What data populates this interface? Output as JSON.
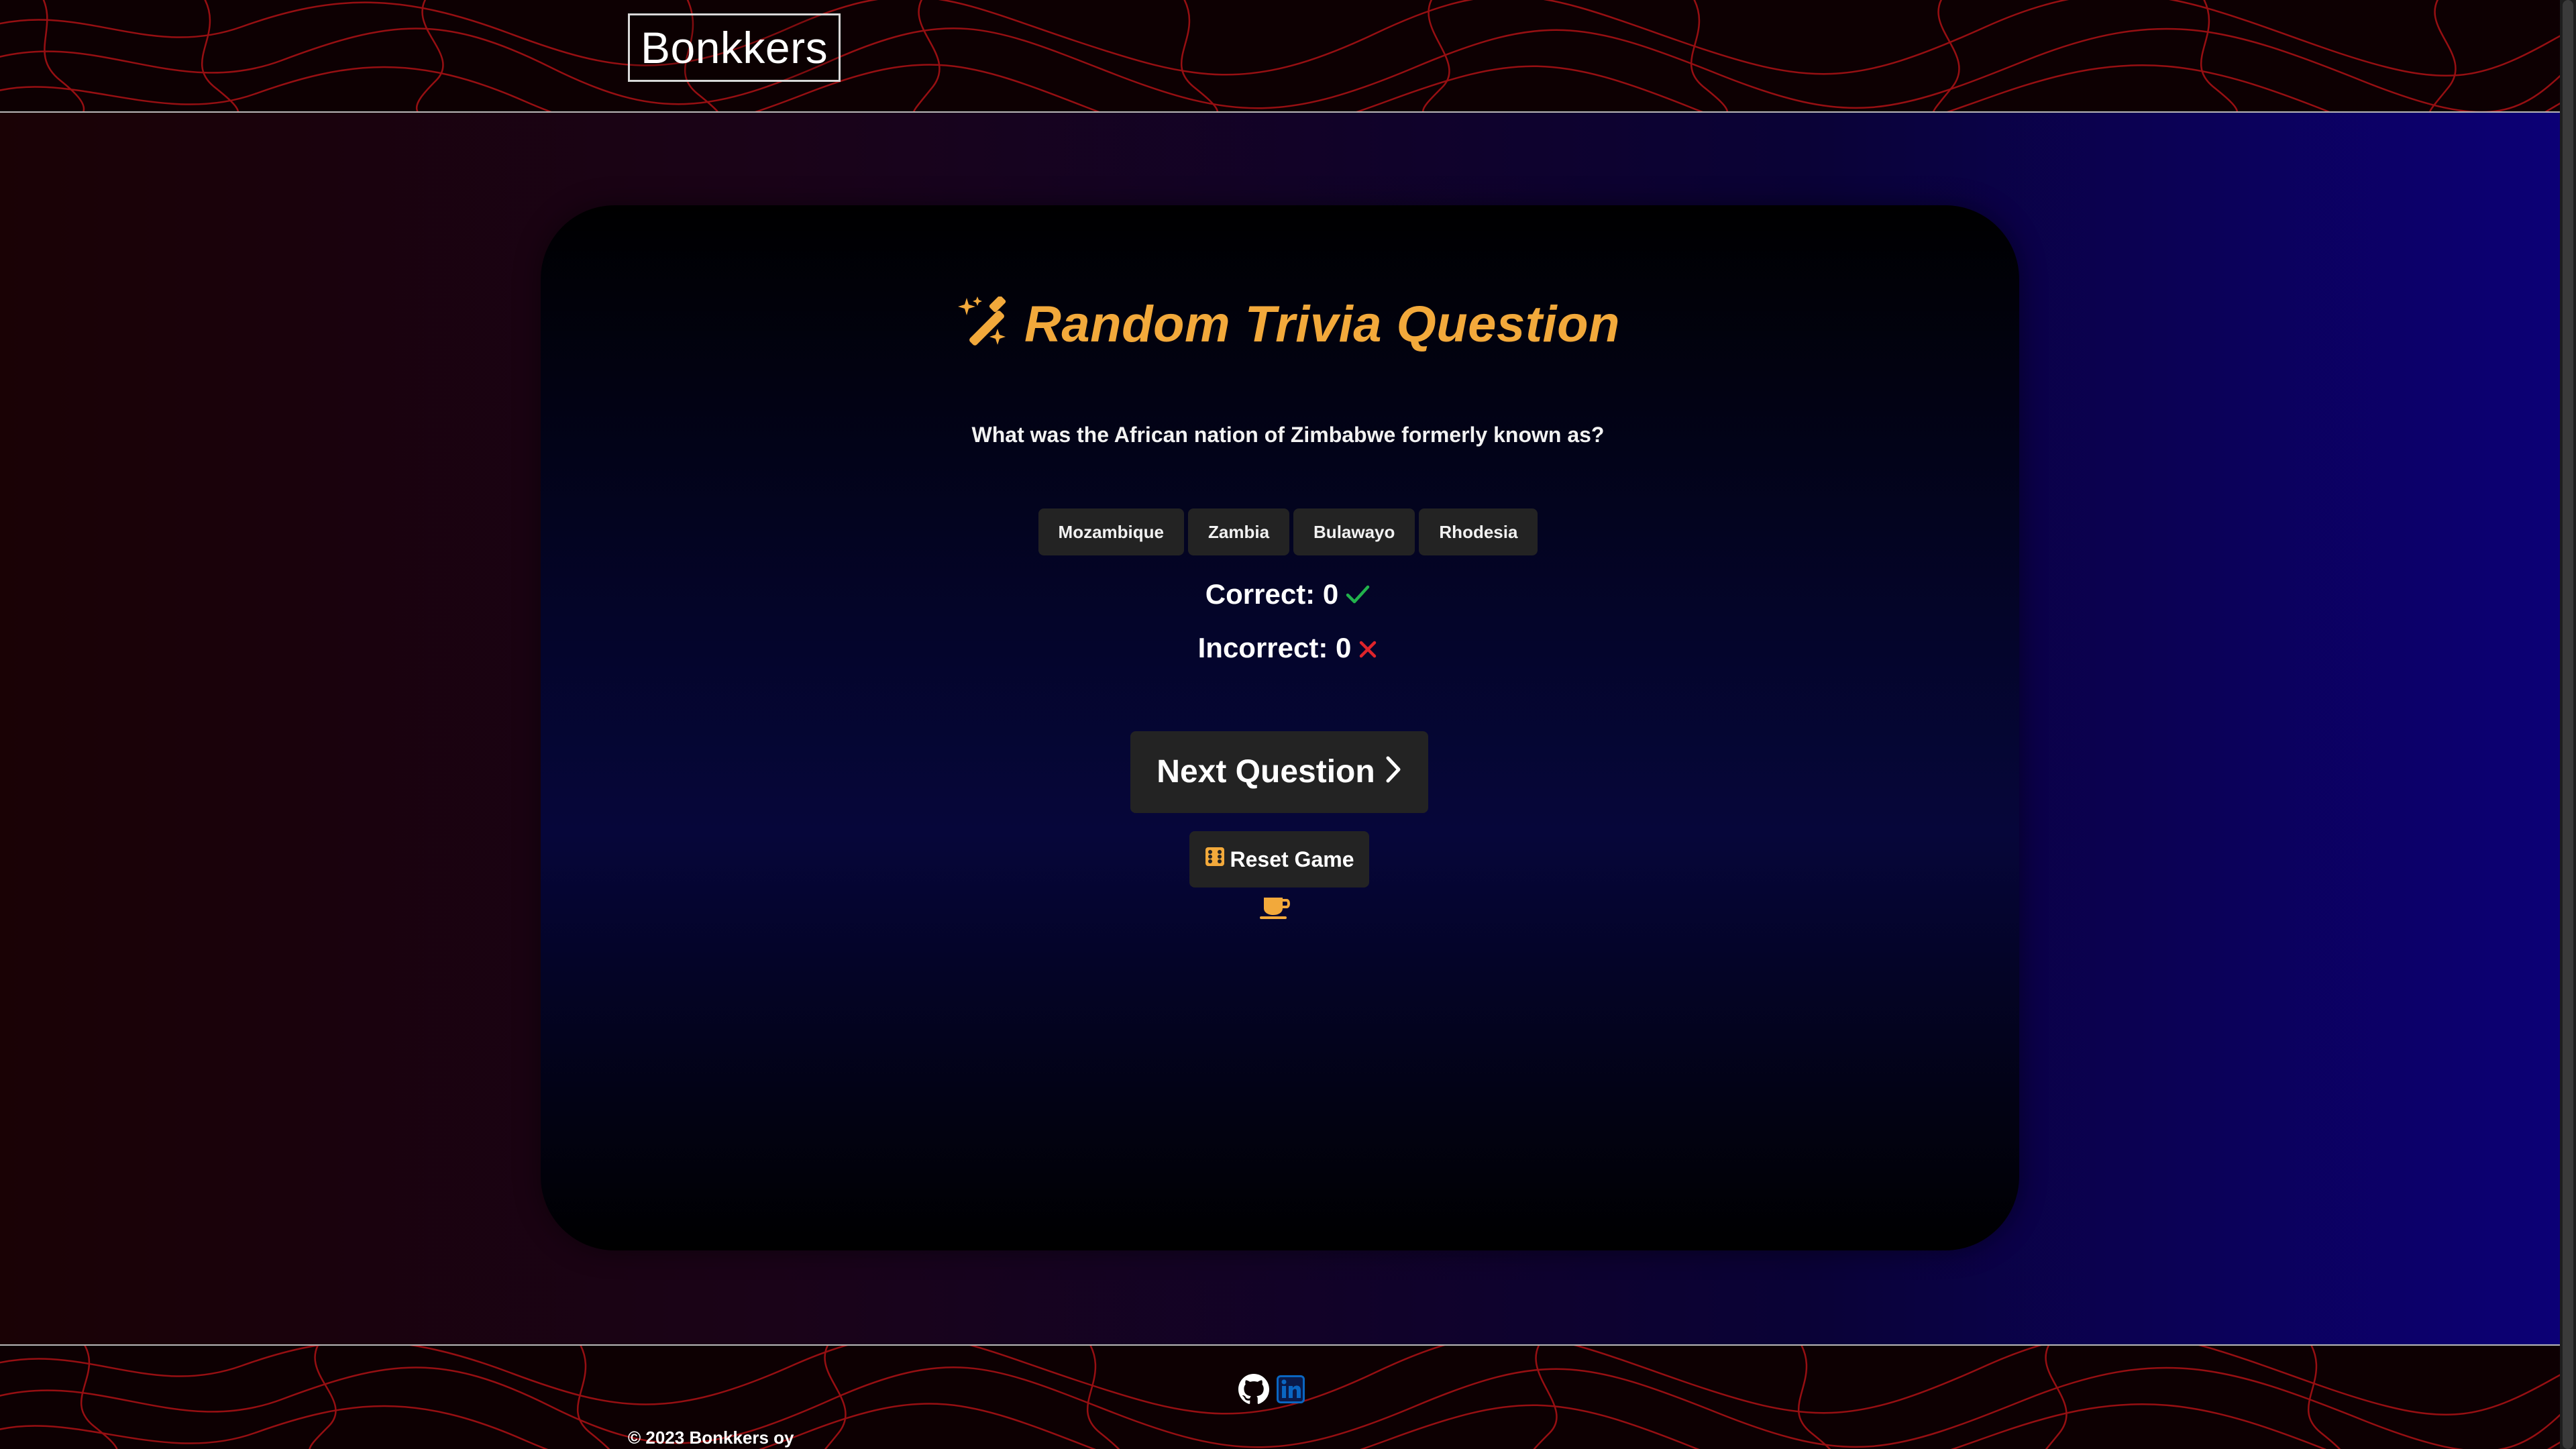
{
  "header": {
    "brand": "Bonkkers"
  },
  "main": {
    "title": "Random Trivia Question",
    "title_icon": "magic-wand-icon",
    "question": "What was the African nation of Zimbabwe formerly known as?",
    "answers": [
      "Mozambique",
      "Zambia",
      "Bulawayo",
      "Rhodesia"
    ],
    "correct_label": "Correct: 0",
    "incorrect_label": "Incorrect: 0",
    "next_label": "Next Question",
    "reset_label": "Reset Game",
    "coffee_icon": "coffee-cup-icon"
  },
  "footer": {
    "github_icon": "github-icon",
    "linkedin_icon": "linkedin-icon",
    "copyright": "© 2023 Bonkkers oy"
  },
  "colors": {
    "accent": "#f2a93b",
    "correct": "#22b24c",
    "incorrect": "#e0242b",
    "linkedin": "#0a66c2",
    "button": "#232323"
  }
}
